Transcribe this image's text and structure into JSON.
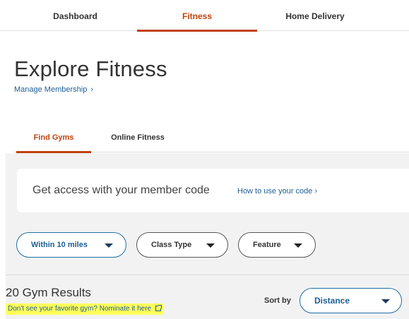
{
  "top_nav": {
    "tabs": [
      {
        "label": "Dashboard",
        "active": false
      },
      {
        "label": "Fitness",
        "active": true
      },
      {
        "label": "Home Delivery",
        "active": false
      }
    ]
  },
  "header": {
    "title": "Explore Fitness",
    "manage_link": "Manage Membership",
    "manage_chevron": "›"
  },
  "sub_tabs": [
    {
      "label": "Find Gyms",
      "active": true
    },
    {
      "label": "Online Fitness",
      "active": false
    }
  ],
  "member_code": {
    "text": "Get access with your member code",
    "link": "How to use your code",
    "link_chevron": "›"
  },
  "filters": {
    "distance": "Within 10 miles",
    "class_type": "Class Type",
    "feature": "Feature"
  },
  "results": {
    "count_text": "20 Gym Results",
    "nominate_text": "Don't see your favorite gym? Nominate it here"
  },
  "sort": {
    "label": "Sort by",
    "selected": "Distance"
  },
  "colors": {
    "accent": "#c2410c",
    "link": "#1d5e95",
    "highlight": "#ffff5c",
    "panel_bg": "#f2f2f2"
  }
}
